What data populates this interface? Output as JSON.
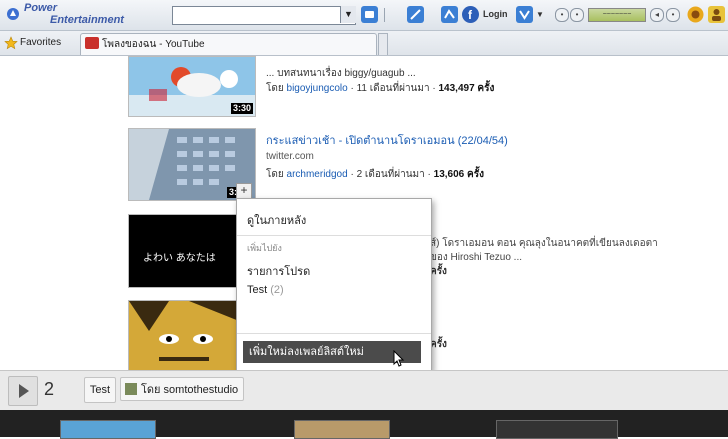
{
  "toolbar": {
    "brand_line1": "Power",
    "brand_line2": "Entertainment",
    "search_value": "",
    "dropdown_glyph": "▼",
    "login_label": "Login",
    "volume_text": "~~~~~~~"
  },
  "favorites_bar": {
    "favorites_label": "Favorites",
    "tab_title": "โพลงของฉน - YouTube"
  },
  "videos": [
    {
      "title": "... บทสนทนาเรื่อง biggy/guagub ...",
      "by_prefix": "โดย",
      "user": "bigoyjungcolo",
      "age": "11 เดือนที่ผ่านมา",
      "views": "143,497 ครั้ง",
      "duration": "3:30"
    },
    {
      "title": "กระแสข่าวเช้า - เปิดตำนานโดราเอมอน (22/04/54)",
      "source": "twitter.com",
      "by_prefix": "โดย",
      "user": "archmeridgod",
      "age": "2 เดือนที่ผ่านมา",
      "views": "13,606 ครั้ง",
      "duration": "3:"
    },
    {
      "desc_line1": "ส์) โดราเอมอน ตอน คุณลุงในอนาคตที่เขียนลงเดอตา",
      "desc_line2": "ของ Hiroshi Tezuo ...",
      "desc_line3": "ครั้ง",
      "thumb_text": "よわい あなたは"
    },
    {
      "views": "ครั้ง"
    }
  ],
  "menu": {
    "plus_glyph": "+",
    "watch_later": "ดูในภายหลัง",
    "add_to_header": "เพิ่มไปยัง",
    "favorites": "รายการโปรด",
    "playlist_name": "Test",
    "playlist_count": "(2)",
    "new_playlist": "เพิ่มใหม่ลงเพลย์ลิสต์ใหม่"
  },
  "bottom": {
    "queue_count": "2",
    "test_label": "Test",
    "channel_label": "โดย somtothestudio"
  },
  "colors": {
    "link": "#1a5cb3",
    "menu_highlight": "#4b4b4b",
    "bottom_strip": "#222222"
  },
  "icons": [
    "logo-icon",
    "dropdown-icon",
    "search-icon",
    "tool-icon",
    "twitter-icon",
    "facebook-icon",
    "settings-icon",
    "volume-icon",
    "star-icon",
    "youtube-icon",
    "play-icon",
    "cursor-icon"
  ]
}
